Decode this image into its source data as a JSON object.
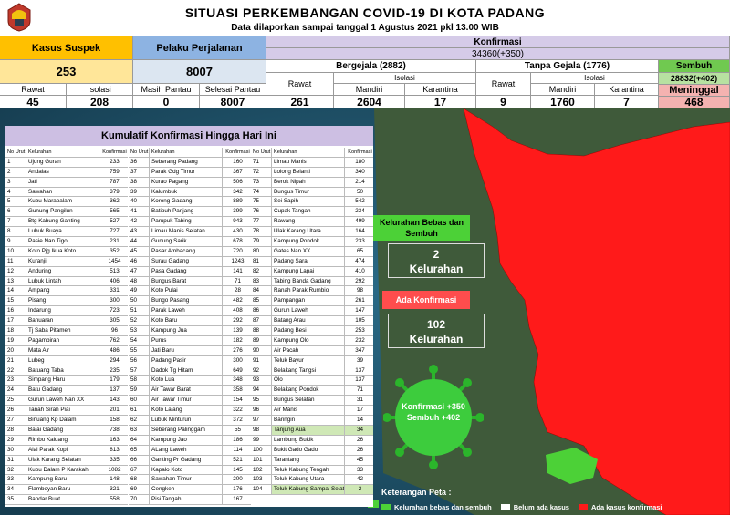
{
  "header": {
    "title": "SITUASI PERKEMBANGAN COVID-19 DI KOTA PADANG",
    "subtitle": "Data dilaporkan sampai tanggal 1 Agustus 2021 pkl 13.00 WIB"
  },
  "stats": {
    "suspek_label": "Kasus Suspek",
    "suspek_value": "253",
    "rawat_label": "Rawat",
    "rawat_value": "45",
    "isolasi_label": "Isolasi",
    "isolasi_value": "208",
    "perjalanan_label": "Pelaku Perjalanan",
    "perjalanan_value": "8007",
    "masih_pantau_label": "Masih Pantau",
    "masih_pantau_value": "0",
    "selesai_pantau_label": "Selesai Pantau",
    "selesai_pantau_value": "8007",
    "konfirmasi_label": "Konfirmasi",
    "konfirmasi_value": "34360(+350)",
    "bergejala_label": "Bergejala (2882)",
    "tanpa_gejala_label": "Tanpa Gejala (1776)",
    "sembuh_label": "Sembuh",
    "sembuh_value": "28832(+402)",
    "bg_rawat_label": "Rawat",
    "bg_isolasi_label": "Isolasi",
    "bg_mandiri_label": "Mandiri",
    "bg_karantina_label": "Karantina",
    "bg_rawat_value": "261",
    "bg_mandiri_value": "2604",
    "bg_karantina_value": "17",
    "tg_rawat_label": "Rawat",
    "tg_isolasi_label": "Isolasi",
    "tg_mandiri_label": "Mandiri",
    "tg_karantina_label": "Karantina",
    "tg_rawat_value": "9",
    "tg_mandiri_value": "1760",
    "tg_karantina_value": "7",
    "meninggal_label": "Meninggal",
    "meninggal_value": "468"
  },
  "table": {
    "title": "Kumulatif Konfirmasi Hingga Hari Ini",
    "headers": [
      "No Urut",
      "Kelurahan",
      "Konfirmasi"
    ],
    "col1": [
      [
        "1",
        "Ujung Guran",
        "233"
      ],
      [
        "2",
        "Andalas",
        "759"
      ],
      [
        "3",
        "Jati",
        "787"
      ],
      [
        "4",
        "Sawahan",
        "379"
      ],
      [
        "5",
        "Kubu Marapalam",
        "362"
      ],
      [
        "6",
        "Gunung Pangilun",
        "565"
      ],
      [
        "7",
        "Btg Kabung Ganting",
        "527"
      ],
      [
        "8",
        "Lubuk Buaya",
        "727"
      ],
      [
        "9",
        "Pasie Nan Tigo",
        "231"
      ],
      [
        "10",
        "Koto Pjg Ikua Koto",
        "352"
      ],
      [
        "11",
        "Kuranji",
        "1454"
      ],
      [
        "12",
        "Anduring",
        "513"
      ],
      [
        "13",
        "Lubuk Lintah",
        "406"
      ],
      [
        "14",
        "Ampang",
        "331"
      ],
      [
        "15",
        "Pisang",
        "300"
      ],
      [
        "16",
        "Indarung",
        "723"
      ],
      [
        "17",
        "Banuaran",
        "305"
      ],
      [
        "18",
        "Tj Saba Pitameh",
        "96"
      ],
      [
        "19",
        "Pagambiran",
        "762"
      ],
      [
        "20",
        "Mata Air",
        "486"
      ],
      [
        "21",
        "Lubeg",
        "294"
      ],
      [
        "22",
        "Batuang Taba",
        "235"
      ],
      [
        "23",
        "Simpang Haru",
        "179"
      ],
      [
        "24",
        "Batu Gadang",
        "137"
      ],
      [
        "25",
        "Gurun Laweh Nan XX",
        "143"
      ],
      [
        "26",
        "Tanah Sirah Piai",
        "201"
      ],
      [
        "27",
        "Binuang Kp Dalam",
        "158"
      ],
      [
        "28",
        "Balai Gadang",
        "738"
      ],
      [
        "29",
        "Rimbo Kaluang",
        "163"
      ],
      [
        "30",
        "Alai Parak Kopi",
        "813"
      ],
      [
        "31",
        "Ulak Karang Selatan",
        "335"
      ],
      [
        "32",
        "Kubu Dalam P Karakah",
        "1082"
      ],
      [
        "33",
        "Kampung Baru",
        "148"
      ],
      [
        "34",
        "Flamboyan Baru",
        "321"
      ],
      [
        "35",
        "Bandar Buat",
        "558"
      ]
    ],
    "col2": [
      [
        "36",
        "Seberang Padang",
        "160"
      ],
      [
        "37",
        "Parak Gdg Timur",
        "367"
      ],
      [
        "38",
        "Kurao Pagang",
        "506"
      ],
      [
        "39",
        "Kalumbuk",
        "342"
      ],
      [
        "40",
        "Korong Gadang",
        "889"
      ],
      [
        "41",
        "Batipuh Panjang",
        "399"
      ],
      [
        "42",
        "Parupuk Tabing",
        "943"
      ],
      [
        "43",
        "Limau Manis Selatan",
        "430"
      ],
      [
        "44",
        "Gunung Sarik",
        "678"
      ],
      [
        "45",
        "Pasar Ambacang",
        "720"
      ],
      [
        "46",
        "Surau Gadang",
        "1243"
      ],
      [
        "47",
        "Pasa Gadang",
        "141"
      ],
      [
        "48",
        "Bungus Barat",
        "71"
      ],
      [
        "49",
        "Koto Pulai",
        "28"
      ],
      [
        "50",
        "Bungo Pasang",
        "482"
      ],
      [
        "51",
        "Parak Laweh",
        "408"
      ],
      [
        "52",
        "Koto Baru",
        "292"
      ],
      [
        "53",
        "Kampung Jua",
        "139"
      ],
      [
        "54",
        "Purus",
        "182"
      ],
      [
        "55",
        "Jati Baru",
        "276"
      ],
      [
        "56",
        "Padang Pasir",
        "300"
      ],
      [
        "57",
        "Dadok Tg Hitam",
        "649"
      ],
      [
        "58",
        "Koto Lua",
        "348"
      ],
      [
        "59",
        "Air Tawar Barat",
        "358"
      ],
      [
        "60",
        "Air Tawar Timur",
        "154"
      ],
      [
        "61",
        "Koto Lalang",
        "322"
      ],
      [
        "62",
        "Lubuk Minturun",
        "372"
      ],
      [
        "63",
        "Seberang Palinggam",
        "55"
      ],
      [
        "64",
        "Kampung Jao",
        "186"
      ],
      [
        "65",
        "ALang Laweh",
        "114"
      ],
      [
        "66",
        "Ganting Pr Gadang",
        "521"
      ],
      [
        "67",
        "Kapalo Koto",
        "145"
      ],
      [
        "68",
        "Sawahan Timur",
        "200"
      ],
      [
        "69",
        "Cengkeh",
        "176"
      ],
      [
        "70",
        "Pisi Tangah",
        "167"
      ]
    ],
    "col3": [
      [
        "71",
        "Limau Manis",
        "180"
      ],
      [
        "72",
        "Lolong Belanti",
        "340"
      ],
      [
        "73",
        "Berok Nipah",
        "214"
      ],
      [
        "74",
        "Bungus Timur",
        "50"
      ],
      [
        "75",
        "Sei Sapih",
        "542"
      ],
      [
        "76",
        "Cupak Tangah",
        "234"
      ],
      [
        "77",
        "Rawang",
        "499"
      ],
      [
        "78",
        "Ulak Karang Utara",
        "164"
      ],
      [
        "79",
        "Kampung Pondok",
        "233"
      ],
      [
        "80",
        "Gates Nan XX",
        "65"
      ],
      [
        "81",
        "Padang Sarai",
        "474"
      ],
      [
        "82",
        "Kampung Lapai",
        "410"
      ],
      [
        "83",
        "Tabing Banda Gadang",
        "292"
      ],
      [
        "84",
        "Ranah Parak Rumbio",
        "98"
      ],
      [
        "85",
        "Pampangan",
        "261"
      ],
      [
        "86",
        "Gurun Laweh",
        "147"
      ],
      [
        "87",
        "Batang Arau",
        "105"
      ],
      [
        "88",
        "Padang Besi",
        "253"
      ],
      [
        "89",
        "Kampung Olo",
        "232"
      ],
      [
        "90",
        "Air Pacah",
        "347"
      ],
      [
        "91",
        "Teluk Bayur",
        "39"
      ],
      [
        "92",
        "Belakang Tangsi",
        "137"
      ],
      [
        "93",
        "Olo",
        "137"
      ],
      [
        "94",
        "Belakang Pondok",
        "71"
      ],
      [
        "95",
        "Bungus Selatan",
        "31"
      ],
      [
        "96",
        "Air Manis",
        "17"
      ],
      [
        "97",
        "Baringin",
        "14"
      ],
      [
        "98",
        "Tanjung Aua",
        "34"
      ],
      [
        "99",
        "Lambung Bukik",
        "26"
      ],
      [
        "100",
        "Bukit Gado Gado",
        "26"
      ],
      [
        "101",
        "Tarantang",
        "45"
      ],
      [
        "102",
        "Teluk Kabung Tengah",
        "33"
      ],
      [
        "103",
        "Teluk Kabung Utara",
        "42"
      ],
      [
        "104",
        "Teluk Kabung Sampai Selatan",
        "2"
      ]
    ]
  },
  "map": {
    "bebas_title": "Kelurahan Bebas dan Sembuh",
    "bebas_value": "2",
    "bebas_unit": "Kelurahan",
    "ada_title": "Ada Konfirmasi",
    "ada_value": "102",
    "ada_unit": "Kelurahan",
    "virus_line1": "Konfirmasi +350",
    "virus_line2": "Sembuh +402"
  },
  "legend": {
    "title": "Keterangan Peta :",
    "items": [
      "Kelurahan bebas dan sembuh",
      "Belum ada kasus",
      "Ada kasus konfirmasi"
    ],
    "colors": [
      "#4cd137",
      "#ffffff",
      "#ff1a1a"
    ]
  },
  "colors": {
    "orange": "#ffc000",
    "blue": "#8db3e2",
    "lavender": "#d5cbe8",
    "green": "#70c950",
    "map_red": "#ff1a1a",
    "map_green": "#4cd137",
    "sea": "#1d4f66"
  }
}
